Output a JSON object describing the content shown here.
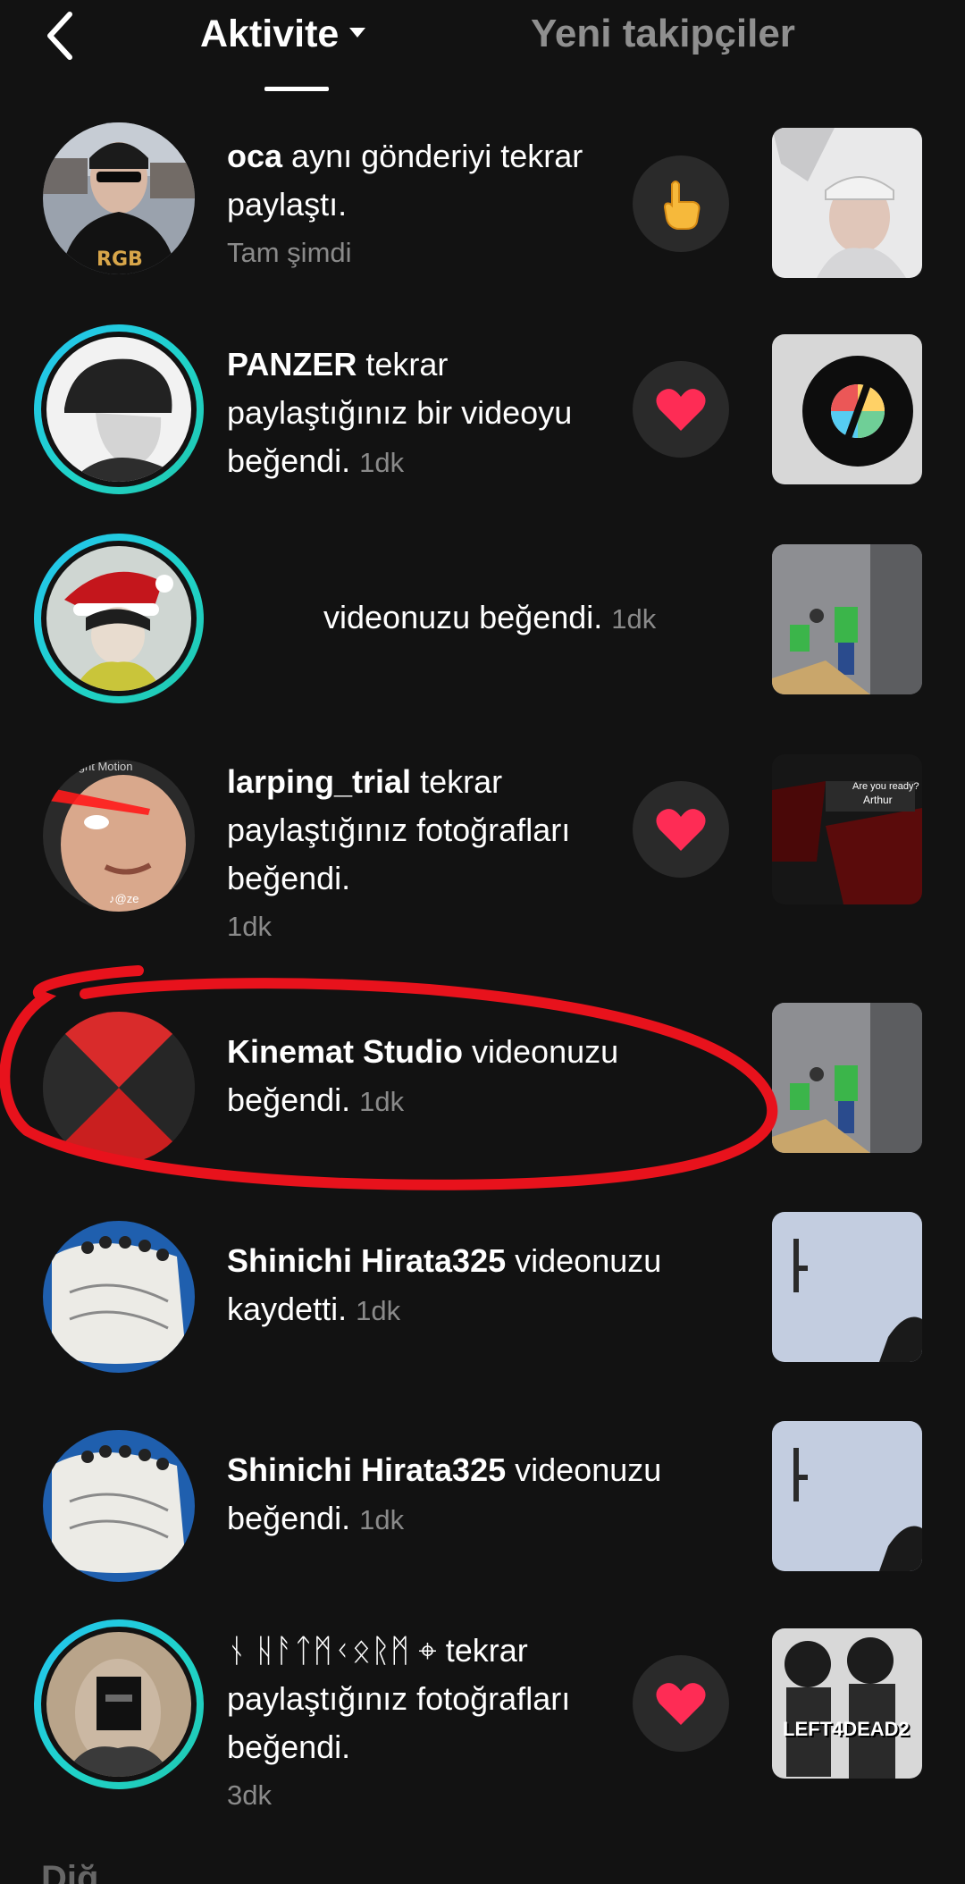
{
  "header": {
    "tab_active": "Aktivite",
    "tab_inactive": "Yeni takipçiler"
  },
  "rows": [
    {
      "user": "oca",
      "action": " aynı gönderiyi tekrar paylaştı.",
      "time": "Tam şimdi",
      "reaction": "pointing-hand"
    },
    {
      "user": "PANZER",
      "action": " tekrar paylaştığınız bir videoyu beğendi.",
      "time": "1dk",
      "reaction": "heart"
    },
    {
      "user": "",
      "action": "videonuzu beğendi.",
      "time": "1dk",
      "reaction": "none"
    },
    {
      "user": "larping_trial",
      "action": " tekrar paylaştığınız fotoğrafları beğendi.",
      "time": "1dk",
      "reaction": "heart"
    },
    {
      "user": "Kinemat Studio",
      "action": " videonuzu beğendi.",
      "time": "1dk",
      "reaction": "none"
    },
    {
      "user": "Shinichi Hirata325",
      "action": " videonuzu kaydetti.",
      "time": "1dk",
      "reaction": "none"
    },
    {
      "user": "Shinichi Hirata325",
      "action": " videonuzu beğendi.",
      "time": "1dk",
      "reaction": "none"
    },
    {
      "user": "ᚾ ᚺᚨᛏᛗᚲᛟᚱᛗ ⌖",
      "action": " tekrar paylaştığınız fotoğrafları beğendi.",
      "time": "3dk",
      "reaction": "heart"
    }
  ],
  "avatar_texts": {
    "larping_watermark": "light Motion",
    "larping_tiktok": "♪@ze"
  },
  "thumb_texts": {
    "are_you_ready": "Are you ready?",
    "arthur": "Arthur",
    "l4d2": "LEFT4DEAD2"
  },
  "bottom_cut": "Diğ",
  "colors": {
    "background": "#121212",
    "ring_start": "#23c3f2",
    "ring_end": "#1fc7b0",
    "heart": "#fe2c55",
    "annotation": "#e8121c"
  }
}
